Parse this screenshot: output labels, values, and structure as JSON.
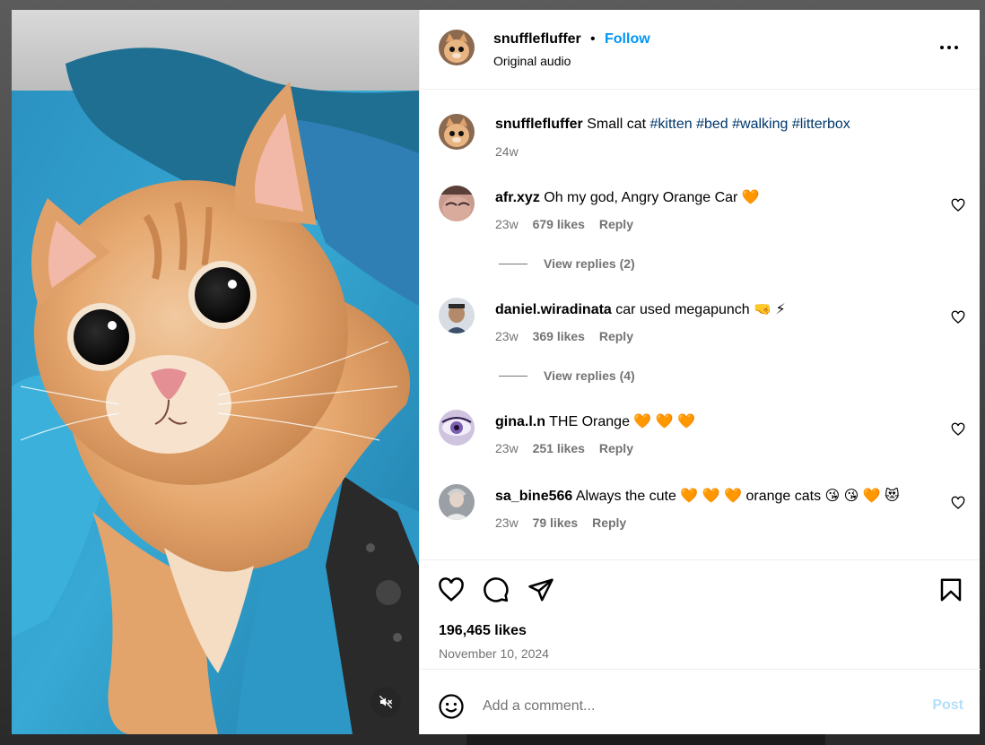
{
  "colors": {
    "accent": "#0095f6",
    "hashtag": "#00376b",
    "secondary_text": "#737373",
    "post_disabled": "#b2dffc",
    "orange_heart": "#f2501f"
  },
  "media": {
    "mute_icon": "speaker-muted-icon"
  },
  "header": {
    "username": "snufflefluffer",
    "separator": "•",
    "follow_label": "Follow",
    "audio_label": "Original audio",
    "more_icon": "more-horizontal-icon"
  },
  "caption": {
    "username": "snufflefluffer",
    "text": "Small cat",
    "hashtags": [
      "#kitten",
      "#bed",
      "#walking",
      "#litterbox"
    ],
    "time": "24w"
  },
  "comments": [
    {
      "username": "afr.xyz",
      "text": "Oh my god, Angry Orange Car",
      "emoji": "🧡",
      "time": "23w",
      "likes": "679 likes",
      "reply": "Reply",
      "view_replies": "View replies (2)"
    },
    {
      "username": "daniel.wiradinata",
      "text": "car used megapunch",
      "emoji": "🤜 ⚡",
      "time": "23w",
      "likes": "369 likes",
      "reply": "Reply",
      "view_replies": "View replies (4)"
    },
    {
      "username": "gina.l.n",
      "text": "THE Orange",
      "emoji": "🧡 🧡 🧡",
      "time": "23w",
      "likes": "251 likes",
      "reply": "Reply",
      "view_replies": ""
    },
    {
      "username": "sa_bine566",
      "text": "Always the cute",
      "emoji_mid": "🧡 🧡 🧡",
      "text_after": "orange cats",
      "emoji_end": "😘 😘 🧡 😻",
      "time": "23w",
      "likes": "79 likes",
      "reply": "Reply",
      "view_replies": ""
    }
  ],
  "actions": {
    "like_icon": "heart-icon",
    "comment_icon": "comment-icon",
    "share_icon": "share-icon",
    "save_icon": "bookmark-icon",
    "likes_count": "196,465 likes",
    "date": "November 10, 2024"
  },
  "comment_box": {
    "emoji_icon": "emoji-icon",
    "placeholder": "Add a comment...",
    "post_label": "Post"
  }
}
